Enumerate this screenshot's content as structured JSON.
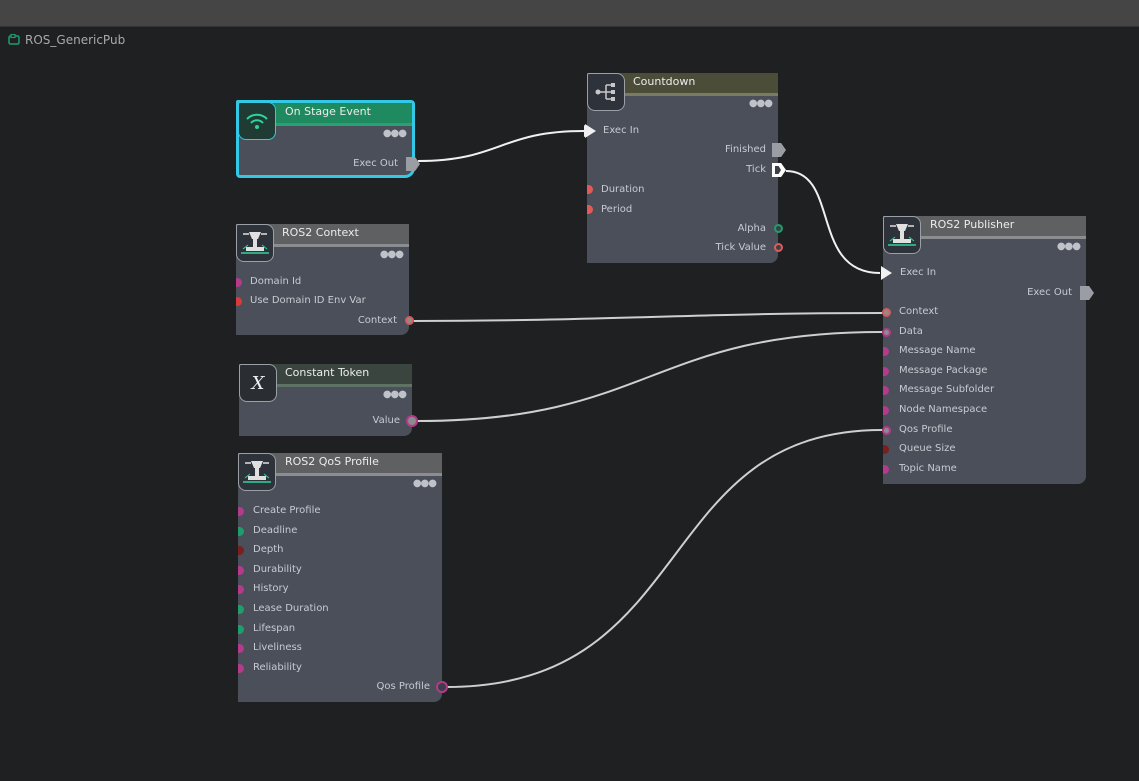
{
  "window": {
    "graph_name": "ROS_GenericPub"
  },
  "colors": {
    "canvas": "#1f2022",
    "node_body": "#4a4f5a",
    "header_green": "#1f8a60",
    "header_gray": "#6c6d6f",
    "header_olive": "#4c4d39",
    "header_dark": "#3b4540",
    "selection": "#33c8e6",
    "wire": "#e6e6e6",
    "pin_magenta": "#b43a8c",
    "pin_red": "#d83b3b",
    "pin_green": "#1f9d6c",
    "pin_darkred": "#7a1f1f",
    "pin_gray": "#8c8c8c",
    "pin_salmon": "#e05a5a"
  },
  "nodes": {
    "on_stage_event": {
      "title": "On Stage Event",
      "icon": "broadcast-icon",
      "outputs": {
        "exec_out": "Exec Out"
      }
    },
    "countdown": {
      "title": "Countdown",
      "icon": "branch-icon",
      "inputs": {
        "exec_in": "Exec In",
        "duration": "Duration",
        "period": "Period"
      },
      "outputs": {
        "finished": "Finished",
        "tick": "Tick",
        "alpha": "Alpha",
        "tick_value": "Tick Value"
      }
    },
    "ros2_context": {
      "title": "ROS2 Context",
      "icon": "ros-robot-icon",
      "inputs": {
        "domain_id": "Domain Id",
        "use_domain_id_env_var": "Use Domain ID Env Var"
      },
      "outputs": {
        "context": "Context"
      }
    },
    "constant_token": {
      "title": "Constant Token",
      "icon": "x-variable-icon",
      "icon_text": "X",
      "outputs": {
        "value": "Value"
      }
    },
    "ros2_qos_profile": {
      "title": "ROS2 QoS Profile",
      "icon": "ros-robot-icon",
      "inputs": {
        "create_profile": "Create Profile",
        "deadline": "Deadline",
        "depth": "Depth",
        "durability": "Durability",
        "history": "History",
        "lease_duration": "Lease Duration",
        "lifespan": "Lifespan",
        "liveliness": "Liveliness",
        "reliability": "Reliability"
      },
      "outputs": {
        "qos_profile": "Qos Profile"
      }
    },
    "ros2_publisher": {
      "title": "ROS2 Publisher",
      "icon": "ros-robot-icon",
      "inputs": {
        "exec_in": "Exec In",
        "context": "Context",
        "data": "Data",
        "message_name": "Message Name",
        "message_package": "Message Package",
        "message_subfolder": "Message Subfolder",
        "node_namespace": "Node Namespace",
        "qos_profile": "Qos Profile",
        "queue_size": "Queue Size",
        "topic_name": "Topic Name"
      },
      "outputs": {
        "exec_out": "Exec Out"
      }
    }
  },
  "connections": [
    {
      "from": "On Stage Event.Exec Out",
      "to": "Countdown.Exec In"
    },
    {
      "from": "Countdown.Tick",
      "to": "ROS2 Publisher.Exec In"
    },
    {
      "from": "ROS2 Context.Context",
      "to": "ROS2 Publisher.Context"
    },
    {
      "from": "Constant Token.Value",
      "to": "ROS2 Publisher.Data"
    },
    {
      "from": "ROS2 QoS Profile.Qos Profile",
      "to": "ROS2 Publisher.Qos Profile"
    }
  ]
}
